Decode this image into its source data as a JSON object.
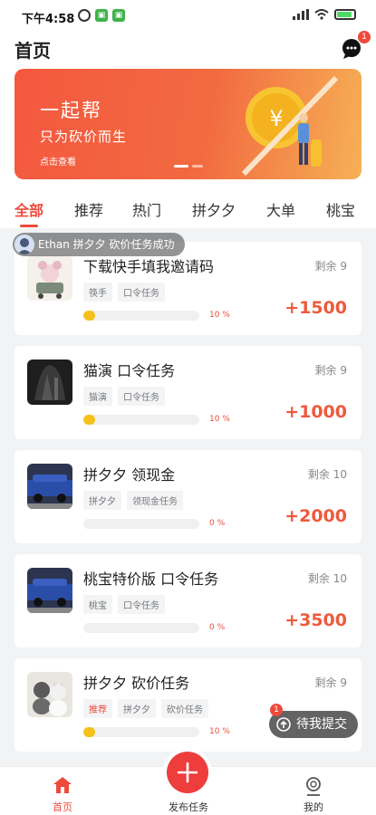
{
  "status_bar": {
    "time": "下午4:58"
  },
  "header": {
    "title": "首页",
    "message_badge": "1"
  },
  "banner": {
    "title": "一起帮",
    "subtitle": "只为砍价而生",
    "link": "点击查看"
  },
  "tabs": [
    {
      "label": "全部",
      "active": true
    },
    {
      "label": "推荐"
    },
    {
      "label": "热门"
    },
    {
      "label": "拼夕夕"
    },
    {
      "label": "大单"
    },
    {
      "label": "桃宝"
    }
  ],
  "toast": "Ethan 拼夕夕 砍价任务成功",
  "tasks": [
    {
      "title": "下载快手填我邀请码",
      "remain": "剩余 9",
      "tags": [
        "筷手",
        "口令任务"
      ],
      "progress_label": "10 %",
      "progress": 0.1,
      "reward": "+1500"
    },
    {
      "title": "猫演 口令任务",
      "remain": "剩余 9",
      "tags": [
        "猫演",
        "口令任务"
      ],
      "progress_label": "10 %",
      "progress": 0.1,
      "reward": "+1000"
    },
    {
      "title": "拼夕夕 领现金",
      "remain": "剩余 10",
      "tags": [
        "拼夕夕",
        "领现金任务"
      ],
      "progress_label": "0 %",
      "progress": 0,
      "reward": "+2000"
    },
    {
      "title": "桃宝特价版 口令任务",
      "remain": "剩余 10",
      "tags": [
        "桃宝",
        "口令任务"
      ],
      "progress_label": "0 %",
      "progress": 0,
      "reward": "+3500"
    },
    {
      "title": "拼夕夕 砍价任务",
      "remain": "剩余 9",
      "tags": [
        "推荐",
        "拼夕夕",
        "砍价任务"
      ],
      "progress_label": "10 %",
      "progress": 0.1,
      "reward": ""
    }
  ],
  "pending": {
    "label": "待我提交",
    "badge": "1"
  },
  "bottom_nav": {
    "home": "首页",
    "publish": "发布任务",
    "mine": "我的"
  },
  "colors": {
    "accent": "#ee4b3b",
    "progress": "#f6c01a",
    "reward": "#ee5a3c"
  }
}
